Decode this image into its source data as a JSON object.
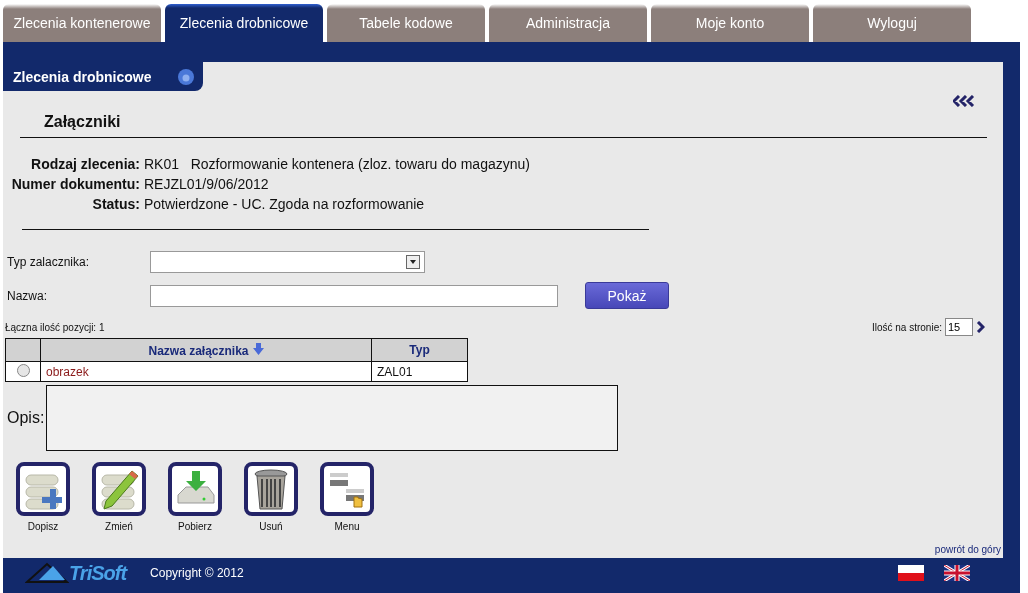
{
  "tabs": [
    {
      "label": "Zlecenia kontenerowe",
      "selected": false
    },
    {
      "label": "Zlecenia drobnicowe",
      "selected": true
    },
    {
      "label": "Tabele kodowe",
      "selected": false
    },
    {
      "label": "Administracja",
      "selected": false
    },
    {
      "label": "Moje konto",
      "selected": false
    },
    {
      "label": "Wyloguj",
      "selected": false
    }
  ],
  "panel": {
    "title": "Zlecenia drobnicowe"
  },
  "section_title": "Załączniki",
  "details": [
    {
      "label": "Rodzaj zlecenia:",
      "code": "RK01",
      "value": "Rozformowanie kontenera (zloz. towaru do magazynu)"
    },
    {
      "label": "Numer dokumentu:",
      "value": "REJZL01/9/06/2012"
    },
    {
      "label": "Status:",
      "value": "Potwierdzone - UC. Zgoda na rozformowanie"
    }
  ],
  "filters": {
    "type_label": "Typ zalacznika:",
    "name_label": "Nazwa:",
    "show_button": "Pokaż"
  },
  "total": "Łączna ilość pozycji: 1",
  "page_size": {
    "label": "Ilość na stronie:",
    "value": "15"
  },
  "table": {
    "columns": [
      {
        "label": "Nazwa załącznika",
        "sorted": true
      },
      {
        "label": "Typ",
        "sorted": false
      }
    ],
    "rows": [
      {
        "name": "obrazek",
        "type": "ZAL01",
        "selected": false
      }
    ]
  },
  "description_label": "Opis:",
  "actions": [
    {
      "kind": "add",
      "label": "Dopisz"
    },
    {
      "kind": "edit",
      "label": "Zmień"
    },
    {
      "kind": "download",
      "label": "Pobierz"
    },
    {
      "kind": "delete",
      "label": "Usuń"
    },
    {
      "kind": "menu",
      "label": "Menu"
    }
  ],
  "back_to_top": "powrót do góry",
  "footer": {
    "logo": "TriSoft",
    "copyright": "Copyright © 2012"
  }
}
